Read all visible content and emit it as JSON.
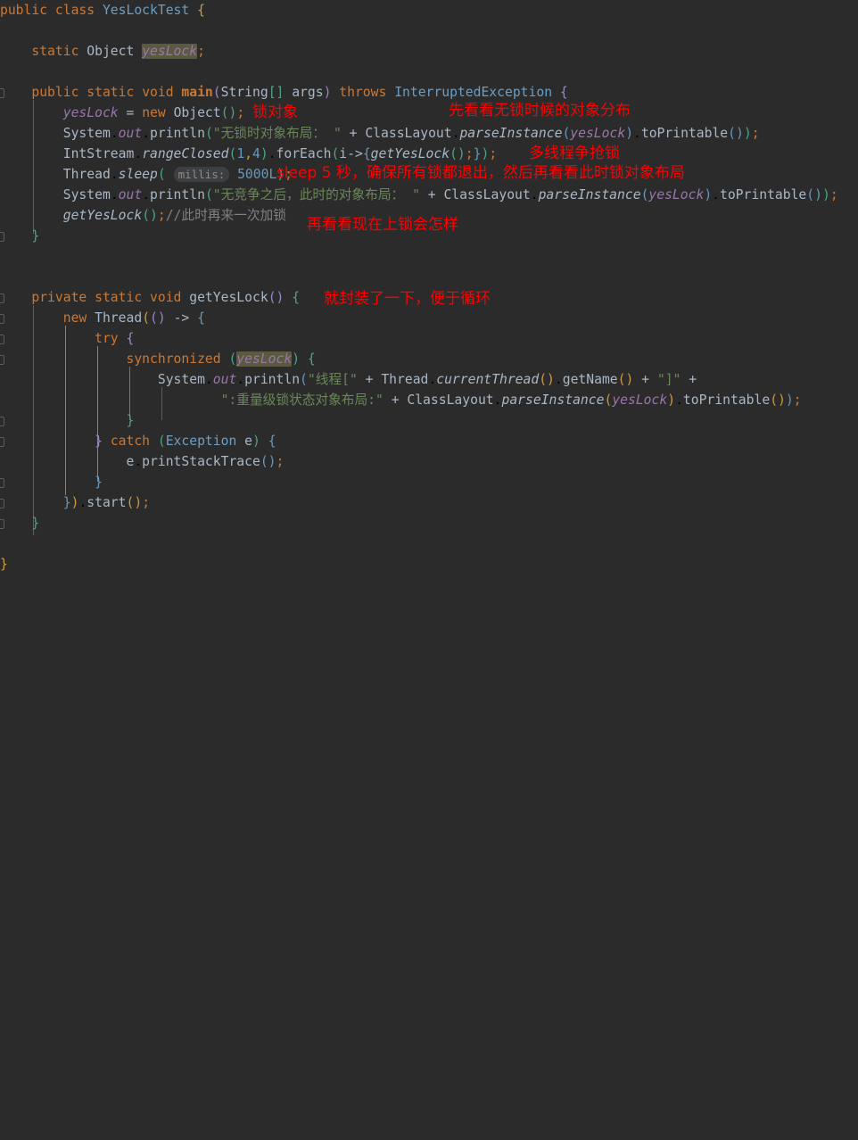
{
  "editor": {
    "language": "java",
    "theme": "darcula",
    "background": "#2b2b2b",
    "foreground": "#a9b7c6"
  },
  "colors": {
    "keyword": "#cc7832",
    "string": "#6a8759",
    "number": "#6897bb",
    "comment": "#808080",
    "field": "#9876aa",
    "class_name": "#6a9ec5",
    "annotation_red": "#ff0000",
    "identifier_highlight": "#5a5a41",
    "inlay_hint_bg": "#3d3f41",
    "bracket_gold": "#cc9a3c",
    "bracket_purple": "#9a86c4",
    "bracket_teal": "#4ba487",
    "bracket_blue": "#6897bb"
  },
  "code": {
    "lines": [
      {
        "n": 1,
        "text": "public class YesLockTest {"
      },
      {
        "n": 2,
        "text": ""
      },
      {
        "n": 3,
        "text": "    static Object yesLock;"
      },
      {
        "n": 4,
        "text": ""
      },
      {
        "n": 5,
        "text": "    public static void main(String[] args) throws InterruptedException {"
      },
      {
        "n": 6,
        "text": "        yesLock = new Object(); 锁对象"
      },
      {
        "n": 7,
        "text": "        System.out.println(\"无锁时对象布局： \" + ClassLayout.parseInstance(yesLock).toPrintable());"
      },
      {
        "n": 8,
        "text": "        IntStream.rangeClosed(1,4).forEach(i->{getYesLock();});"
      },
      {
        "n": 9,
        "text": "        Thread.sleep( millis: 5000L);"
      },
      {
        "n": 10,
        "text": "        System.out.println(\"无竞争之后，此时的对象布局： \" + ClassLayout.parseInstance(yesLock).toPrintable());"
      },
      {
        "n": 11,
        "text": "        getYesLock();//此时再来一次加锁"
      },
      {
        "n": 12,
        "text": "    }"
      },
      {
        "n": 13,
        "text": ""
      },
      {
        "n": 14,
        "text": ""
      },
      {
        "n": 15,
        "text": "    private static void getYesLock() {"
      },
      {
        "n": 16,
        "text": "        new Thread(() -> {"
      },
      {
        "n": 17,
        "text": "            try {"
      },
      {
        "n": 18,
        "text": "                synchronized (yesLock) {"
      },
      {
        "n": 19,
        "text": "                    System.out.println(\"线程[\" + Thread.currentThread().getName() + \"]\" +"
      },
      {
        "n": 20,
        "text": "                            \":重量级锁状态对象布局:\" + ClassLayout.parseInstance(yesLock).toPrintable());"
      },
      {
        "n": 21,
        "text": "                }"
      },
      {
        "n": 22,
        "text": "            } catch (Exception e) {"
      },
      {
        "n": 23,
        "text": "                e.printStackTrace();"
      },
      {
        "n": 24,
        "text": "            }"
      },
      {
        "n": 25,
        "text": "        }).start();"
      },
      {
        "n": 26,
        "text": "    }"
      },
      {
        "n": 27,
        "text": ""
      },
      {
        "n": 28,
        "text": "}"
      }
    ],
    "inlay_hints": [
      {
        "line": 9,
        "label": "millis:"
      }
    ],
    "highlighted_identifier": "yesLock"
  },
  "annotations": [
    {
      "id": "anno-1",
      "text": "锁对象",
      "line": 6
    },
    {
      "id": "anno-2",
      "text": "先看看无锁时候的对象分布",
      "line": 5
    },
    {
      "id": "anno-3",
      "text": "多线程争抢锁",
      "line": 8
    },
    {
      "id": "anno-4",
      "text": "sleep 5 秒，确保所有锁都退出，然后再看看此时锁对象布局",
      "line": 9
    },
    {
      "id": "anno-5",
      "text": "再看看现在上锁会怎样",
      "line": 11
    },
    {
      "id": "anno-6",
      "text": "就封装了一下，便于循环",
      "line": 15
    }
  ],
  "comments": [
    {
      "line": 11,
      "text": "//此时再来一次加锁"
    }
  ],
  "strings": [
    {
      "line": 7,
      "text": "\"无锁时对象布局： \""
    },
    {
      "line": 10,
      "text": "\"无竞争之后，此时的对象布局： \""
    },
    {
      "line": 19,
      "text": "\"线程[\""
    },
    {
      "line": 19,
      "text": "\"]\""
    },
    {
      "line": 20,
      "text": "\":重量级锁状态对象布局:\""
    }
  ]
}
